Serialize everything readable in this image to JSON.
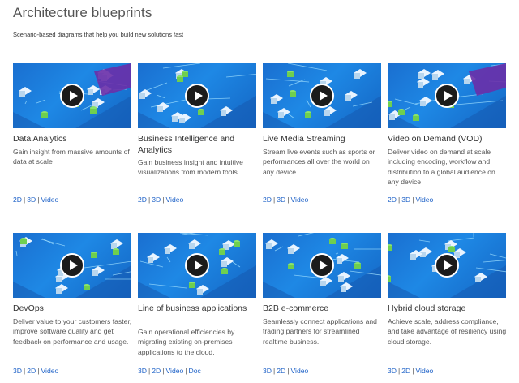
{
  "page": {
    "title": "Architecture blueprints",
    "subtitle": "Scenario-based diagrams that help you build new solutions fast"
  },
  "cards": [
    {
      "title": "Data Analytics",
      "description": "Gain insight from massive amounts of data at scale",
      "links": [
        "2D",
        "3D",
        "Video"
      ]
    },
    {
      "title": "Business Intelligence and Analytics",
      "description": "Gain business insight and intuitive visualizations from modern tools",
      "links": [
        "2D",
        "3D",
        "Video"
      ]
    },
    {
      "title": "Live Media Streaming",
      "description": "Stream live events such as sports or performances all over the world on any device",
      "links": [
        "2D",
        "3D",
        "Video"
      ]
    },
    {
      "title": "Video on Demand (VOD)",
      "description": "Deliver video on demand at scale including encoding, workflow and distribution to a global audience on any device",
      "links": [
        "2D",
        "3D",
        "Video"
      ]
    },
    {
      "title": "DevOps",
      "description": "Deliver value to your customers faster, improve software quality and get feedback on performance and usage.",
      "links": [
        "3D",
        "2D",
        "Video"
      ]
    },
    {
      "title": "Line of business applications",
      "description": "Gain operational efficiencies by migrating existing on-premises applications to the cloud.",
      "links": [
        "3D",
        "2D",
        "Video",
        "Doc"
      ]
    },
    {
      "title": "B2B e-commerce",
      "description": "Seamlessly connect applications and trading partners for streamlined realtime business.",
      "links": [
        "3D",
        "2D",
        "Video"
      ]
    },
    {
      "title": "Hybrid cloud storage",
      "description": "Achieve scale, address compliance, and take advantage of resiliency using cloud storage.",
      "links": [
        "3D",
        "2D",
        "Video"
      ]
    }
  ],
  "icons": {
    "play": "play-icon"
  },
  "colors": {
    "link": "#1e62c8",
    "thumb_blue": "#1e88e5",
    "play_bg": "#1b1b1b"
  }
}
